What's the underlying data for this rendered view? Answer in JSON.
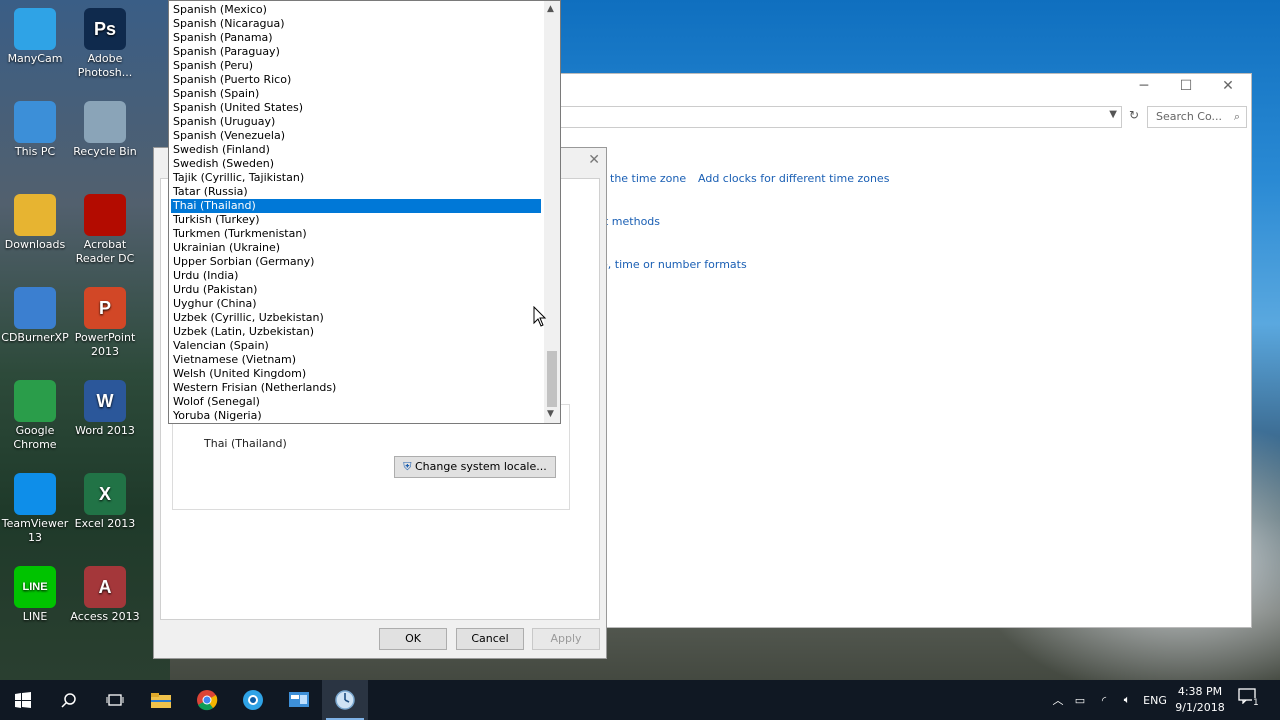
{
  "desktop": {
    "icons": [
      {
        "label": "ManyCam",
        "icon": "manycam-icon",
        "color": "#2fa3e6"
      },
      {
        "label": "Adobe Photosh...",
        "icon": "photoshop-icon",
        "color": "#0f2a4d",
        "glyph": "Ps"
      },
      {
        "label": "This PC",
        "icon": "computer-icon",
        "color": "#3c8fd8"
      },
      {
        "label": "Recycle Bin",
        "icon": "recycle-bin-icon",
        "color": "#8aa4b8"
      },
      {
        "label": "Downloads",
        "icon": "downloads-folder-icon",
        "color": "#e7b431"
      },
      {
        "label": "Acrobat Reader DC",
        "icon": "acrobat-icon",
        "color": "#b30b00"
      },
      {
        "label": "CDBurnerXP",
        "icon": "cdburner-icon",
        "color": "#3b7fd0"
      },
      {
        "label": "PowerPoint 2013",
        "icon": "powerpoint-icon",
        "color": "#d24726",
        "glyph": "P"
      },
      {
        "label": "Google Chrome",
        "icon": "chrome-icon",
        "color": "#2a9d4a"
      },
      {
        "label": "Word 2013",
        "icon": "word-icon",
        "color": "#2b579a",
        "glyph": "W"
      },
      {
        "label": "TeamViewer 13",
        "icon": "teamviewer-icon",
        "color": "#0e8ee9"
      },
      {
        "label": "Excel 2013",
        "icon": "excel-icon",
        "color": "#217346",
        "glyph": "X"
      },
      {
        "label": "LINE",
        "icon": "line-icon",
        "color": "#00c300",
        "glyph": "LINE"
      },
      {
        "label": "Access 2013",
        "icon": "access-icon",
        "color": "#a4373a",
        "glyph": "A"
      }
    ]
  },
  "control_panel": {
    "search_placeholder": "Search Co...",
    "links": [
      "the time zone",
      "Add clocks for different time zones",
      "t methods",
      "e, time or number formats"
    ]
  },
  "dialog": {
    "current_locale": "Thai (Thailand)",
    "change_locale_button": "Change system locale...",
    "ok": "OK",
    "cancel": "Cancel",
    "apply": "Apply"
  },
  "locale_list": {
    "items": [
      "Spanish (Mexico)",
      "Spanish (Nicaragua)",
      "Spanish (Panama)",
      "Spanish (Paraguay)",
      "Spanish (Peru)",
      "Spanish (Puerto Rico)",
      "Spanish (Spain)",
      "Spanish (United States)",
      "Spanish (Uruguay)",
      "Spanish (Venezuela)",
      "Swedish (Finland)",
      "Swedish (Sweden)",
      "Tajik (Cyrillic, Tajikistan)",
      "Tatar (Russia)",
      "Thai (Thailand)",
      "Turkish (Turkey)",
      "Turkmen (Turkmenistan)",
      "Ukrainian (Ukraine)",
      "Upper Sorbian (Germany)",
      "Urdu (India)",
      "Urdu (Pakistan)",
      "Uyghur (China)",
      "Uzbek (Cyrillic, Uzbekistan)",
      "Uzbek (Latin, Uzbekistan)",
      "Valencian (Spain)",
      "Vietnamese (Vietnam)",
      "Welsh (United Kingdom)",
      "Western Frisian (Netherlands)",
      "Wolof (Senegal)",
      "Yoruba (Nigeria)"
    ],
    "selected": "Thai (Thailand)"
  },
  "taskbar": {
    "apps": [
      "start-icon",
      "search-icon",
      "task-view-icon",
      "file-explorer-icon",
      "chrome-icon",
      "manycam-icon",
      "control-panel-icon",
      "region-settings-icon"
    ],
    "language": "ENG",
    "time": "4:38 PM",
    "date": "9/1/2018",
    "notification_count": "1"
  }
}
